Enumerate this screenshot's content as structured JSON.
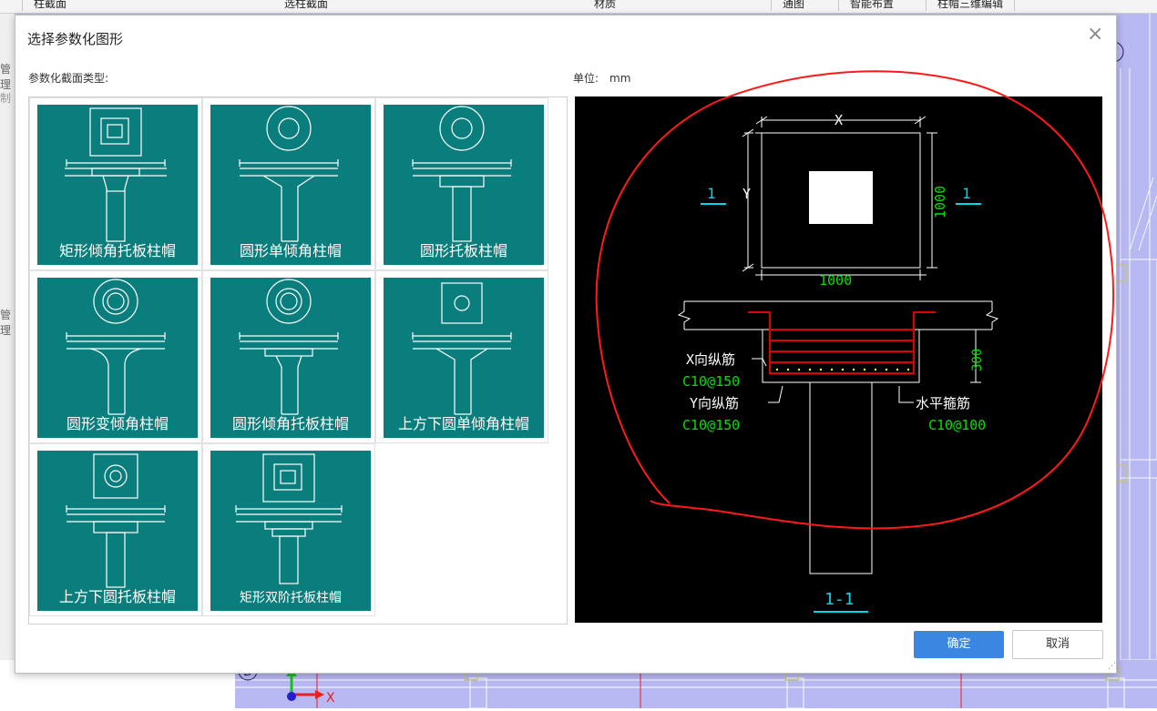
{
  "background": {
    "toolbar": [
      {
        "label": "柱截面"
      },
      {
        "label": "选柱截面"
      },
      {
        "label": "材质"
      },
      {
        "label": "通图"
      },
      {
        "label": "智能布置"
      },
      {
        "label": "柱帽三维编辑"
      }
    ],
    "left_tabs": [
      "管理",
      "制",
      "管理"
    ],
    "axis_labels": {
      "circle_top": "6",
      "circle_bottom": "D",
      "x_axis": "X"
    }
  },
  "dialog": {
    "title": "选择参数化图形",
    "close_label": "×",
    "section_label": "参数化截面类型:",
    "unit_label": "单位:",
    "unit_value": "mm",
    "shapes": [
      {
        "label": "矩形倾角托板柱帽",
        "icon": "rect-sloped-slab-cap-icon"
      },
      {
        "label": "圆形单倾角柱帽",
        "icon": "circle-single-slope-cap-icon"
      },
      {
        "label": "圆形托板柱帽",
        "icon": "circle-slab-cap-icon"
      },
      {
        "label": "圆形变倾角柱帽",
        "icon": "circle-variable-slope-cap-icon"
      },
      {
        "label": "圆形倾角托板柱帽",
        "icon": "circle-sloped-slab-cap-icon"
      },
      {
        "label": "上方下圆单倾角柱帽",
        "icon": "square-circle-single-slope-cap-icon"
      },
      {
        "label": "上方下圆托板柱帽",
        "icon": "square-circle-slab-cap-icon"
      },
      {
        "label": "矩形双阶托板柱帽",
        "icon": "rect-double-step-slab-cap-icon"
      }
    ],
    "preview": {
      "dim_x": "X",
      "dim_y": "Y",
      "dim_width": "1000",
      "dim_height": "1000",
      "section_mark": "1",
      "dim_slab": "300",
      "x_rebar_label": "X向纵筋",
      "x_rebar_value": "C10@150",
      "y_rebar_label": "Y向纵筋",
      "y_rebar_value": "C10@150",
      "stirrup_label": "水平箍筋",
      "stirrup_value": "C10@100",
      "section_title": "1-1"
    },
    "ok_label": "确定",
    "cancel_label": "取消",
    "resize_grip": "⋰"
  },
  "colors": {
    "tile_bg": "#0a7d7d",
    "preview_bg": "#000000",
    "green_text": "#00e000",
    "cyan_text": "#00d8e8",
    "rebar_red": "#e00000",
    "ok_blue": "#3a86e0",
    "annotation_red": "#ff1a1a",
    "cad_canvas": "#b8b8f2"
  }
}
